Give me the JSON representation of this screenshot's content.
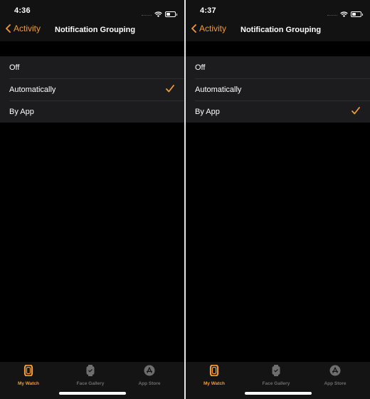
{
  "accent_color": "#f09a36",
  "panels": [
    {
      "status_time": "4:36",
      "back_label": "Activity",
      "title": "Notification Grouping",
      "options": [
        {
          "label": "Off",
          "selected": false
        },
        {
          "label": "Automatically",
          "selected": true
        },
        {
          "label": "By App",
          "selected": false
        }
      ],
      "tabs": [
        {
          "label": "My Watch",
          "icon": "watch-icon",
          "active": true
        },
        {
          "label": "Face Gallery",
          "icon": "watch-face-icon",
          "active": false
        },
        {
          "label": "App Store",
          "icon": "app-store-icon",
          "active": false
        }
      ]
    },
    {
      "status_time": "4:37",
      "back_label": "Activity",
      "title": "Notification Grouping",
      "options": [
        {
          "label": "Off",
          "selected": false
        },
        {
          "label": "Automatically",
          "selected": false
        },
        {
          "label": "By App",
          "selected": true
        }
      ],
      "tabs": [
        {
          "label": "My Watch",
          "icon": "watch-icon",
          "active": true
        },
        {
          "label": "Face Gallery",
          "icon": "watch-face-icon",
          "active": false
        },
        {
          "label": "App Store",
          "icon": "app-store-icon",
          "active": false
        }
      ]
    }
  ]
}
